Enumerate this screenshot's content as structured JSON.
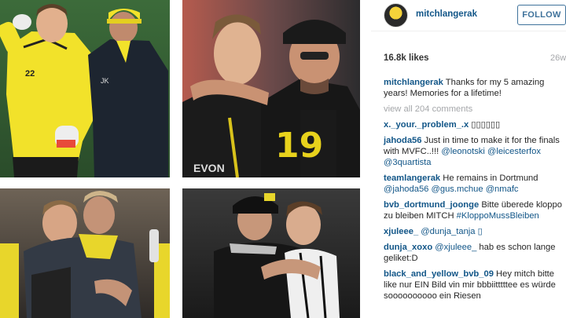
{
  "post": {
    "username": "mitchlangerak",
    "follow_label": "FOLLOW",
    "likes": "16.8k likes",
    "time_ago": "26w",
    "caption": "Thanks for my 5 amazing years! Memories for a lifetime!",
    "view_all": "view all 204 comments"
  },
  "comments": [
    {
      "user": "x._your._problem_.x",
      "text": "▯▯▯▯▯▯"
    },
    {
      "user": "jahoda56",
      "text": "Just in time to make it for the finals with MVFC..!!! ",
      "mentions": "@leonotski @leicesterfox @3quartista"
    },
    {
      "user": "teamlangerak",
      "text": "He remains in Dortmund ",
      "mentions": "@jahoda56 @gus.mchue @nmafc"
    },
    {
      "user": "bvb_dortmund_joonge",
      "text": "Bitte überede kloppo zu bleiben MITCH ",
      "mentions": "#KloppoMussBleiben"
    },
    {
      "user": "xjuleee_",
      "text": "",
      "mentions": "@dunja_tanja ▯"
    },
    {
      "user": "dunja_xoxo",
      "text": " hab es schon lange geliket:D",
      "mentions": "@xjuleee_",
      "mention_first": true
    },
    {
      "user": "black_and_yellow_bvb_09",
      "text": "Hey mitch bitte like nur EIN Bild vin mir bbbiitttttee es würde soooooooooo ein Riesen"
    }
  ],
  "photos": [
    {
      "jersey_number": "22",
      "initials": "JK"
    },
    {
      "jersey_number": "19",
      "sponsor": "EVON"
    },
    {},
    {}
  ]
}
